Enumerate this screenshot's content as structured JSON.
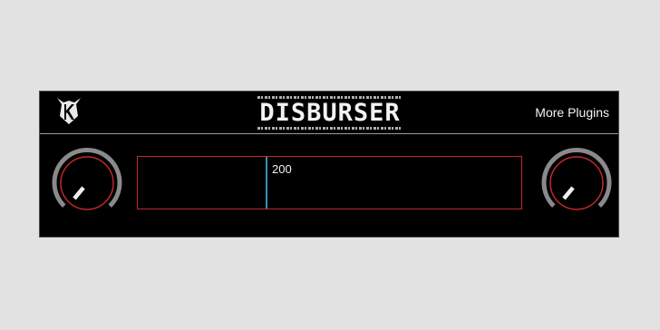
{
  "header": {
    "title": "DISBURSER",
    "more_plugins_label": "More Plugins",
    "logo": "kx-logo"
  },
  "knobs": {
    "left": {
      "name": "left-knob",
      "level": 0.15
    },
    "right": {
      "name": "right-knob",
      "level": 0.15
    }
  },
  "display": {
    "value": "200",
    "marker_level": 0.33
  },
  "colors": {
    "background": "#000000",
    "accent_red": "#c0282d",
    "marker_blue": "#3a8fbd",
    "text": "#f2f2f2"
  }
}
